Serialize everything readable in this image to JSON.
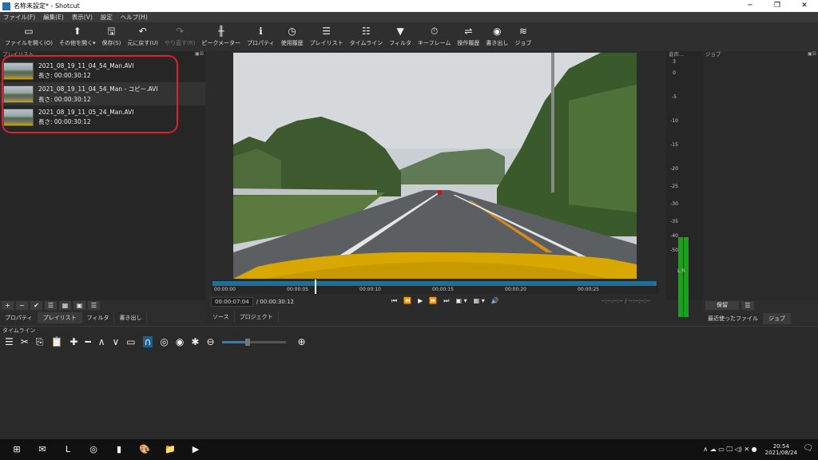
{
  "window": {
    "title": "名称未設定* - Shotcut",
    "min": "─",
    "max": "❐",
    "close": "✕"
  },
  "menu": [
    "ファイル(F)",
    "編集(E)",
    "表示(V)",
    "設定",
    "ヘルプ(H)"
  ],
  "toolbar": [
    {
      "label": "ファイルを開く(O)",
      "icon": "folder-open-icon",
      "glyph": "▭",
      "disabled": false
    },
    {
      "label": "その他を開く▾",
      "icon": "open-other-icon",
      "glyph": "⬆",
      "disabled": false
    },
    {
      "label": "保存(S)",
      "icon": "save-icon",
      "glyph": "🖫",
      "disabled": false
    },
    {
      "label": "元に戻す(U)",
      "icon": "undo-icon",
      "glyph": "↶",
      "disabled": false
    },
    {
      "label": "やり直す(R)",
      "icon": "redo-icon",
      "glyph": "↷",
      "disabled": true
    },
    {
      "label": "ピークメーター",
      "icon": "peak-meter-icon",
      "glyph": "╫",
      "disabled": false
    },
    {
      "label": "プロパティ",
      "icon": "properties-icon",
      "glyph": "ℹ",
      "disabled": false
    },
    {
      "label": "使用履歴",
      "icon": "history-icon",
      "glyph": "◷",
      "disabled": false
    },
    {
      "label": "プレイリスト",
      "icon": "playlist-icon",
      "glyph": "☰",
      "disabled": false
    },
    {
      "label": "タイムライン",
      "icon": "timeline-icon",
      "glyph": "☷",
      "disabled": false
    },
    {
      "label": "フィルタ",
      "icon": "filter-icon",
      "glyph": "▼",
      "disabled": false
    },
    {
      "label": "キーフレーム",
      "icon": "keyframe-icon",
      "glyph": "⏱",
      "disabled": false
    },
    {
      "label": "操作履歴",
      "icon": "undo-history-icon",
      "glyph": "⇌",
      "disabled": false
    },
    {
      "label": "書き出し",
      "icon": "export-icon",
      "glyph": "◉",
      "disabled": false
    },
    {
      "label": "ジョブ",
      "icon": "jobs-icon",
      "glyph": "≋",
      "disabled": false
    }
  ],
  "playlist": {
    "header": "プレイリスト",
    "items": [
      {
        "name": "2021_08_19_11_04_54_Man.AVI",
        "duration": "長さ: 00:00:30:12"
      },
      {
        "name": "2021_08_19_11_04_54_Man - コピー.AVI",
        "duration": "長さ: 00:00:30:12"
      },
      {
        "name": "2021_08_19_11_05_24_Man.AVI",
        "duration": "長さ: 00:00:30:12"
      }
    ],
    "buttons": [
      "+",
      "−",
      "✔",
      "☰",
      "▦",
      "▣",
      "☰"
    ],
    "tabs": [
      "プロパティ",
      "プレイリスト",
      "フィルタ",
      "書き出し"
    ]
  },
  "viewer": {
    "ruler_labels": [
      "00:00:00",
      "00:00:05",
      "00:00:10",
      "00:00:15",
      "00:00:20",
      "00:00:25"
    ],
    "playhead_fraction": 0.23,
    "timecode": "00:00:07:04",
    "total": "/ 00:00:30:12",
    "controls": [
      "⏮",
      "⏪",
      "▶",
      "⏩",
      "⏭",
      "▣ ▾",
      "▦ ▾",
      "🔊"
    ],
    "inout": "--:--:--:-- /  --:--:--:--",
    "tabs": [
      "ソース",
      "プロジェクト"
    ]
  },
  "meter": {
    "header": "音声…",
    "scale": [
      "3",
      "0",
      "-5",
      "-10",
      "-15",
      "-20",
      "-25",
      "-30",
      "-35",
      "-40",
      "-50"
    ],
    "lr": "L R"
  },
  "jobs": {
    "header": "ジョブ",
    "pause": "保留",
    "menu": "☰",
    "tabs": [
      "最近使ったファイル",
      "ジョブ"
    ]
  },
  "timeline": {
    "header": "タイムライン",
    "tools": [
      {
        "name": "menu-icon",
        "glyph": "☰"
      },
      {
        "name": "cut-icon",
        "glyph": "✂"
      },
      {
        "name": "copy-icon",
        "glyph": "⎘"
      },
      {
        "name": "paste-icon",
        "glyph": "📋"
      },
      {
        "name": "append-icon",
        "glyph": "✚"
      },
      {
        "name": "remove-icon",
        "glyph": "━"
      },
      {
        "name": "lift-icon",
        "glyph": "∧"
      },
      {
        "name": "overwrite-icon",
        "glyph": "∨"
      },
      {
        "name": "split-icon",
        "glyph": "▭"
      },
      {
        "name": "snap-icon",
        "glyph": "∩",
        "active": true
      },
      {
        "name": "scrub-icon",
        "glyph": "◎"
      },
      {
        "name": "ripple-icon",
        "glyph": "◉"
      },
      {
        "name": "ripple-all-icon",
        "glyph": "✱"
      },
      {
        "name": "zoom-out-icon",
        "glyph": "⊖"
      }
    ],
    "zoom_in": "⊕",
    "zoom_fraction": 0.4
  },
  "taskbar": {
    "apps": [
      {
        "name": "start-icon",
        "glyph": "⊞"
      },
      {
        "name": "mail-icon",
        "glyph": "✉"
      },
      {
        "name": "app-l-icon",
        "glyph": "L"
      },
      {
        "name": "chrome-icon",
        "glyph": "◎"
      },
      {
        "name": "shotcut-icon",
        "glyph": "▮"
      },
      {
        "name": "paint-icon",
        "glyph": "🎨"
      },
      {
        "name": "explorer-icon",
        "glyph": "📁"
      },
      {
        "name": "media-icon",
        "glyph": "▶"
      }
    ],
    "tray": "∧ ☁ ▭ 🖵 ◁) ✕ ●",
    "time": "20:54",
    "date": "2021/08/24",
    "notifications": "🗨"
  }
}
